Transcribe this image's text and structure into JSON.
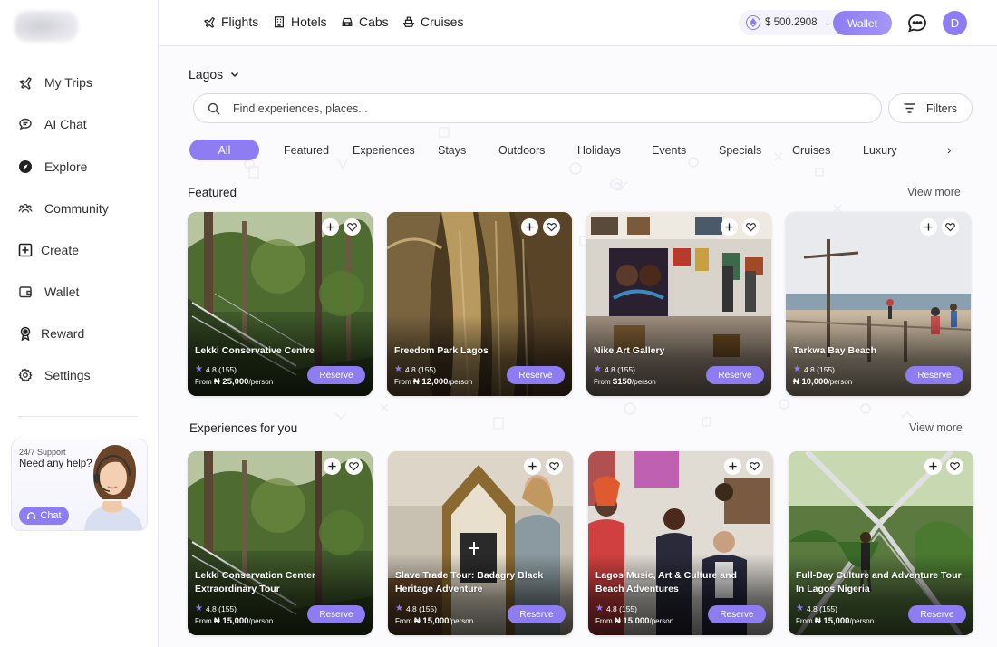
{
  "sidebar": {
    "items": [
      {
        "label": "My Trips",
        "icon": "plane-icon"
      },
      {
        "label": "AI Chat",
        "icon": "chat-bubble-icon"
      },
      {
        "label": "Explore",
        "icon": "compass-icon"
      },
      {
        "label": "Community",
        "icon": "people-icon"
      },
      {
        "label": "Create",
        "icon": "plus-square-icon"
      },
      {
        "label": "Wallet",
        "icon": "wallet-icon"
      },
      {
        "label": "Reward",
        "icon": "award-icon"
      },
      {
        "label": "Settings",
        "icon": "gear-icon"
      }
    ],
    "support": {
      "small": "24/7 Support",
      "big": "Need any help?",
      "chat_label": "Chat"
    }
  },
  "topnav": {
    "items": [
      {
        "label": "Flights",
        "icon": "plane-icon"
      },
      {
        "label": "Hotels",
        "icon": "hotel-icon"
      },
      {
        "label": "Cabs",
        "icon": "car-icon"
      },
      {
        "label": "Cruises",
        "icon": "ship-icon"
      }
    ],
    "balance": "$ 500.2908",
    "wallet_label": "Wallet",
    "avatar_initial": "D"
  },
  "location": "Lagos",
  "search": {
    "placeholder": "Find experiences, places..."
  },
  "filters_label": "Filters",
  "categories": [
    "All",
    "Featured",
    "Experiences",
    "Stays",
    "Outdoors",
    "Holidays",
    "Events",
    "Specials",
    "Cruises",
    "Luxury"
  ],
  "featured": {
    "title": "Featured",
    "view_more": "View more",
    "cards": [
      {
        "title": "Lekki Conservative Centre",
        "rating": "4.8 (155)",
        "price_prefix": "From",
        "price": "₦ 25,000",
        "price_suffix": "/person",
        "reserve": "Reserve"
      },
      {
        "title": "Freedom Park Lagos",
        "rating": "4.8 (155)",
        "price_prefix": "From",
        "price": "₦ 12,000",
        "price_suffix": "/person",
        "reserve": "Reserve"
      },
      {
        "title": "Nike Art Gallery",
        "rating": "4.8 (155)",
        "price_prefix": "From",
        "price": "$150",
        "price_suffix": "/person",
        "reserve": "Reserve"
      },
      {
        "title": "Tarkwa Bay Beach",
        "rating": "4.8 (155)",
        "price_prefix": "",
        "price": "₦ 10,000",
        "price_suffix": "/person",
        "reserve": "Reserve"
      }
    ]
  },
  "experiences": {
    "title": "Experiences for you",
    "view_more": "View more",
    "cards": [
      {
        "title": "Lekki Conservation Center Extraordinary Tour",
        "rating": "4.8 (155)",
        "price_prefix": "From",
        "price": "₦ 15,000",
        "price_suffix": "/person",
        "reserve": "Reserve"
      },
      {
        "title": "Slave Trade Tour: Badagry Black Heritage Adventure",
        "rating": "4.8 (155)",
        "price_prefix": "From",
        "price": "₦ 15,000",
        "price_suffix": "/person",
        "reserve": "Reserve"
      },
      {
        "title": "Lagos Music, Art & Culture and Beach Adventures",
        "rating": "4.8 (155)",
        "price_prefix": "From",
        "price": "₦ 15,000",
        "price_suffix": "/person",
        "reserve": "Reserve"
      },
      {
        "title": "Full-Day Culture and Adventure Tour In Lagos Nigeria",
        "rating": "4.8 (155)",
        "price_prefix": "From",
        "price": "₦ 15,000",
        "price_suffix": "/person",
        "reserve": "Reserve"
      }
    ]
  },
  "colors": {
    "accent": "#8d7cf2",
    "text": "#1f1f2b",
    "border": "#e6e6ec"
  }
}
